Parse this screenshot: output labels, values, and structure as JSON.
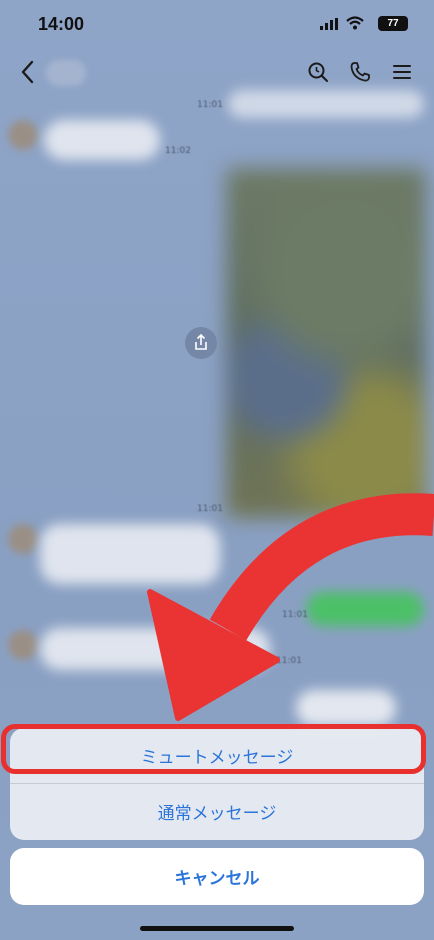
{
  "status_bar": {
    "time": "14:00",
    "battery": "77"
  },
  "nav": {
    "back_icon": "chevron-left-icon",
    "icons": [
      "search-icon",
      "phone-icon",
      "menu-icon"
    ]
  },
  "chat": {
    "timestamps": [
      "11:01",
      "11:02",
      "11:01",
      "11:01",
      "11:01"
    ]
  },
  "action_sheet": {
    "mute_label": "ミュートメッセージ",
    "normal_label": "通常メッセージ",
    "cancel_label": "キャンセル"
  },
  "colors": {
    "accent": "#2b74d9",
    "annotation": "#e8312f"
  }
}
